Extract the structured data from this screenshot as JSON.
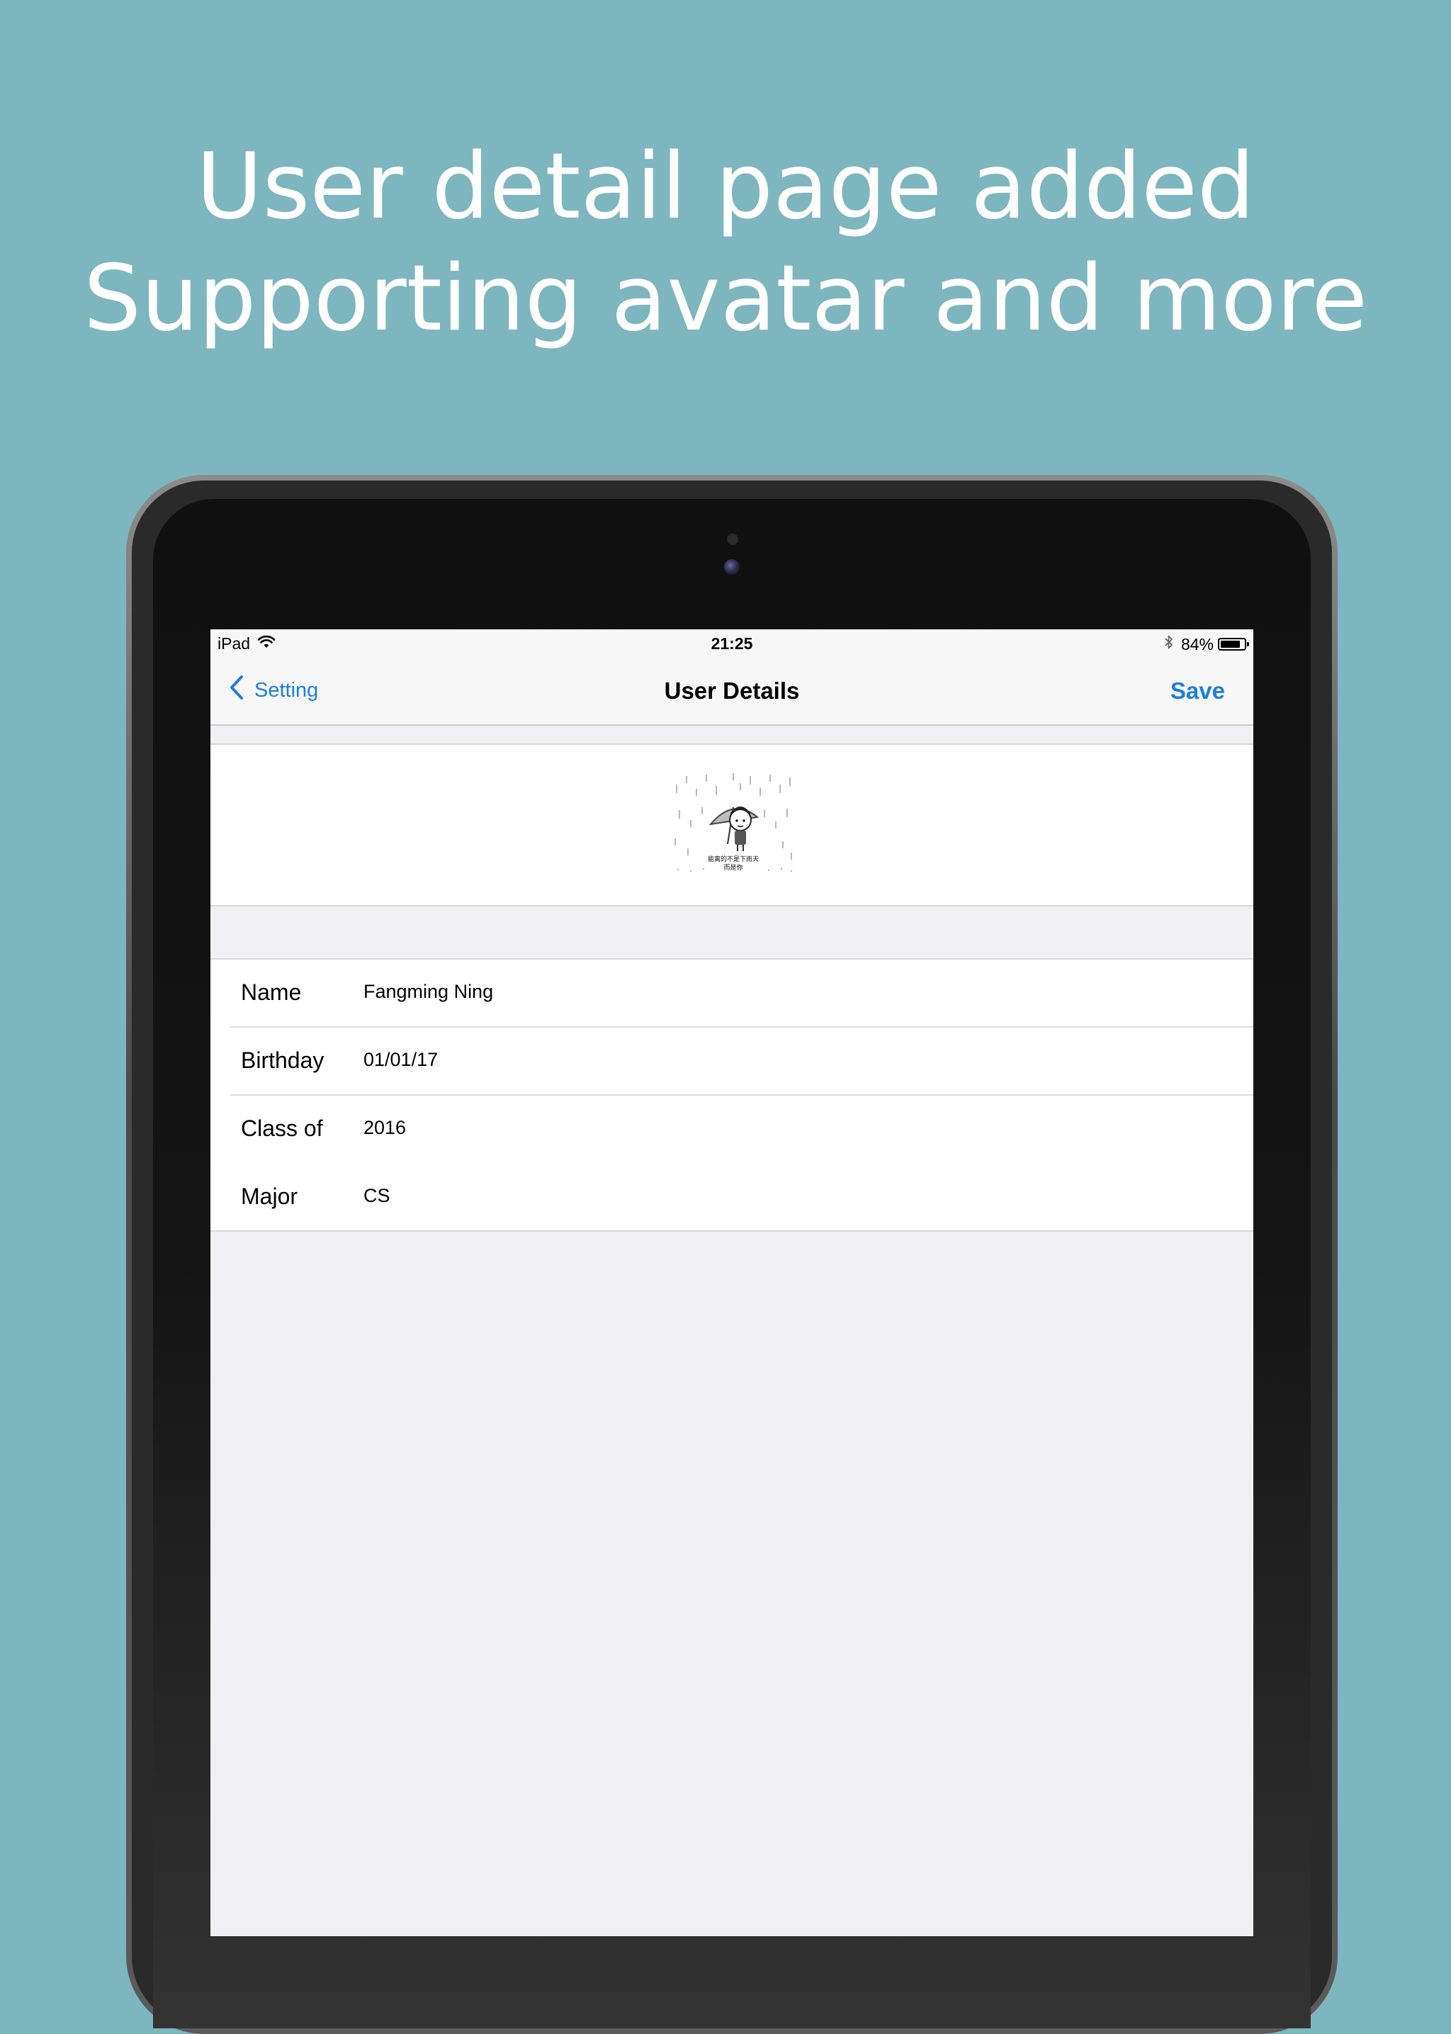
{
  "headline": {
    "line1": "User detail page added",
    "line2": "Supporting avatar and more"
  },
  "status_bar": {
    "carrier": "iPad",
    "time": "21:25",
    "battery_text": "84%",
    "battery_level": 0.84,
    "icons": [
      "wifi-icon",
      "bluetooth-icon",
      "battery-icon"
    ]
  },
  "nav": {
    "back_label": "Setting",
    "title": "User Details",
    "save_label": "Save"
  },
  "avatar": {
    "caption_line1": "能离的不是下雨天",
    "caption_line2": "而是你"
  },
  "form": {
    "rows": [
      {
        "label": "Name",
        "value": "Fangming Ning"
      },
      {
        "label": "Birthday",
        "value": "01/01/17"
      },
      {
        "label": "Class of",
        "value": "2016"
      },
      {
        "label": "Major",
        "value": "CS"
      }
    ]
  },
  "colors": {
    "background": "#7db6bf",
    "accent": "#1a7ee6",
    "grouped_bg": "#efeff4"
  }
}
